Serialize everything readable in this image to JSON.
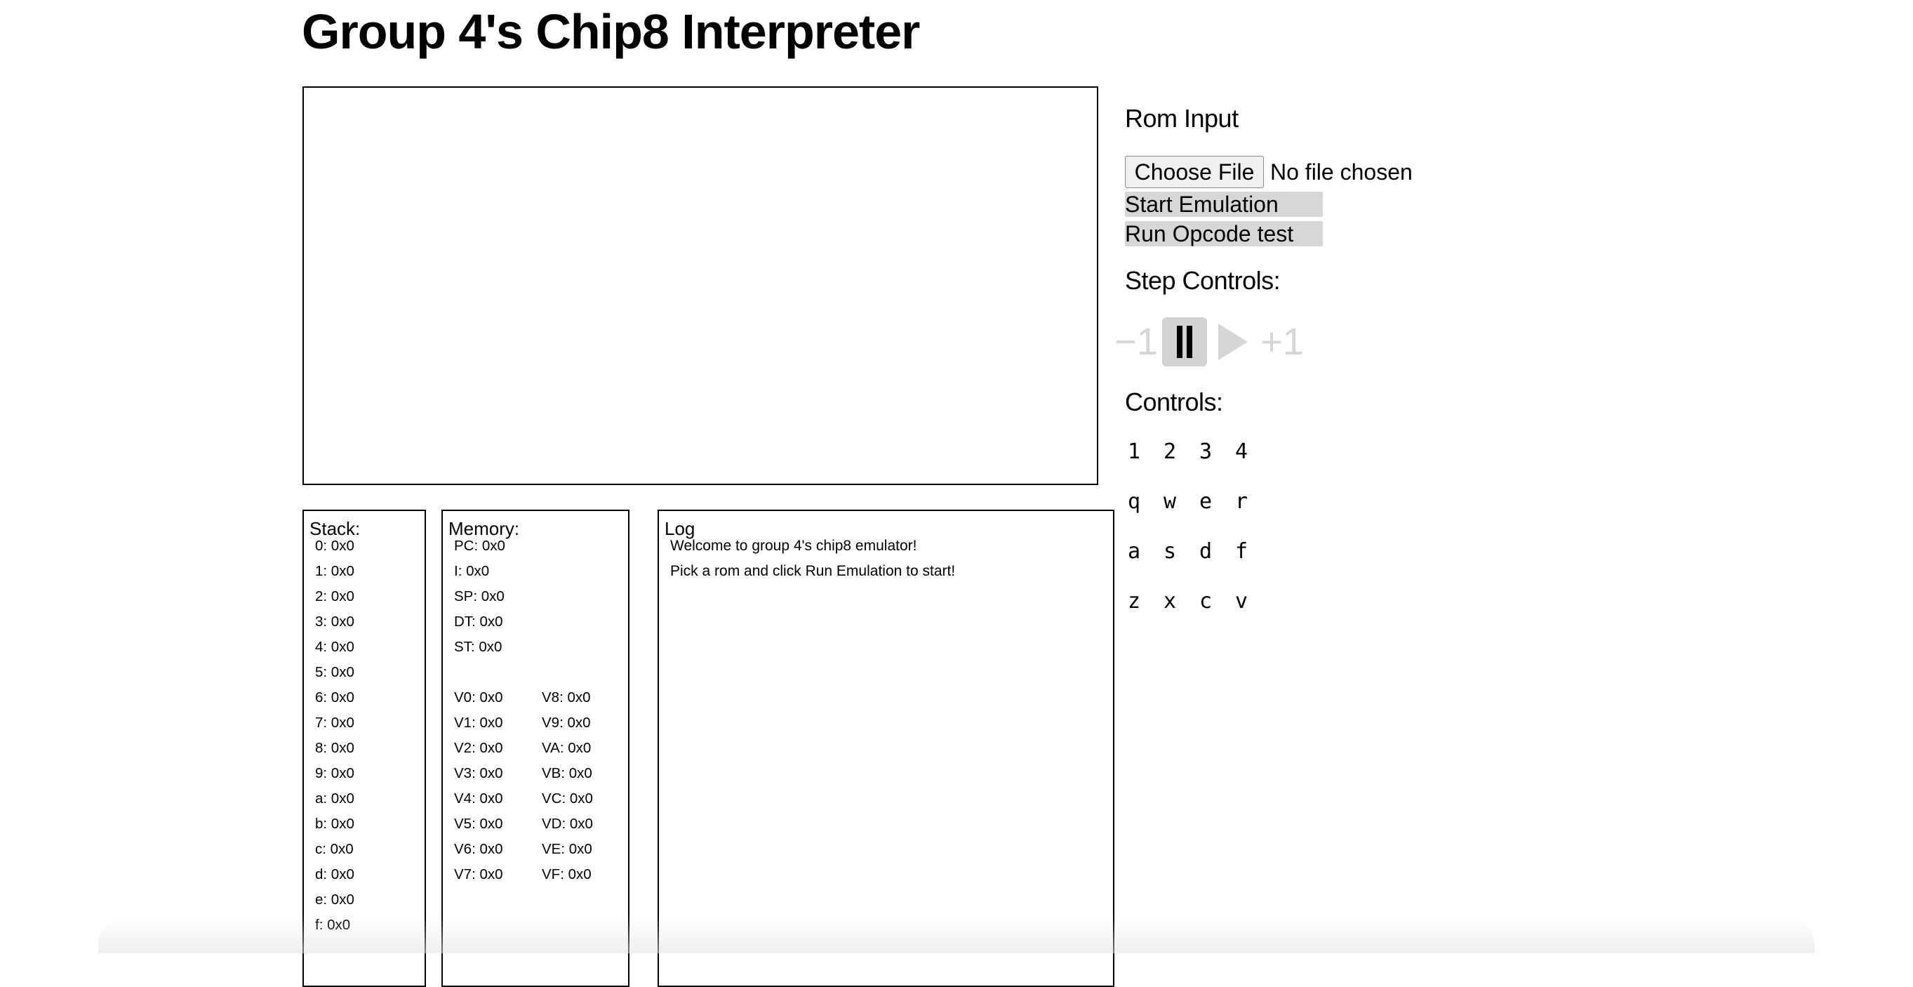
{
  "header": {
    "title": "Group 4's Chip8 Interpreter"
  },
  "stack": {
    "title": "Stack:",
    "entries": [
      "0: 0x0",
      "1: 0x0",
      "2: 0x0",
      "3: 0x0",
      "4: 0x0",
      "5: 0x0",
      "6: 0x0",
      "7: 0x0",
      "8: 0x0",
      "9: 0x0",
      "a: 0x0",
      "b: 0x0",
      "c: 0x0",
      "d: 0x0",
      "e: 0x0",
      "f: 0x0"
    ]
  },
  "memory": {
    "title": "Memory:",
    "special": [
      "PC: 0x0",
      "I: 0x0",
      "SP: 0x0",
      "DT: 0x0",
      "ST: 0x0"
    ],
    "registers_left": [
      "V0: 0x0",
      "V1: 0x0",
      "V2: 0x0",
      "V3: 0x0",
      "V4: 0x0",
      "V5: 0x0",
      "V6: 0x0",
      "V7: 0x0"
    ],
    "registers_right": [
      "V8: 0x0",
      "V9: 0x0",
      "VA: 0x0",
      "VB: 0x0",
      "VC: 0x0",
      "VD: 0x0",
      "VE: 0x0",
      "VF: 0x0"
    ]
  },
  "log": {
    "title": "Log",
    "line1": "Welcome to group 4's chip8 emulator!",
    "line2_prefix": "Pick a rom and click ",
    "line2_emphasis": "Run Emulation",
    "line2_suffix": " to start!"
  },
  "rom": {
    "heading": "Rom Input",
    "choose_label": "Choose File",
    "file_status": "No file chosen",
    "start_label": "Start Emulation",
    "opcode_label": "Run Opcode test"
  },
  "step": {
    "heading": "Step Controls:",
    "back_label": "−1",
    "forward_label": "+1"
  },
  "controls": {
    "heading": "Controls:",
    "keys": [
      [
        "1",
        "2",
        "3",
        "4"
      ],
      [
        "q",
        "w",
        "e",
        "r"
      ],
      [
        "a",
        "s",
        "d",
        "f"
      ],
      [
        "z",
        "x",
        "c",
        "v"
      ]
    ]
  }
}
